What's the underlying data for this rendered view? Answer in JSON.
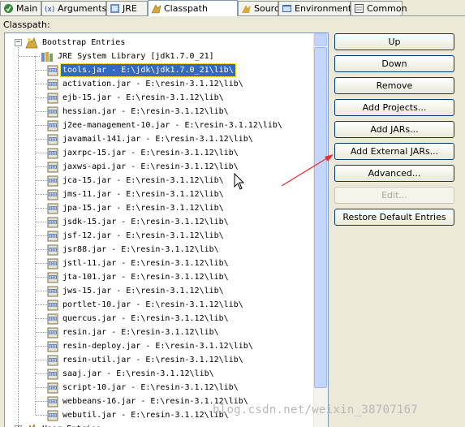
{
  "tabs": [
    {
      "label": "Main",
      "icon": "main-icon"
    },
    {
      "label": "Arguments",
      "icon": "arguments-icon"
    },
    {
      "label": "JRE",
      "icon": "jre-icon"
    },
    {
      "label": "Classpath",
      "icon": "classpath-icon",
      "active": true
    },
    {
      "label": "Source",
      "icon": "source-icon"
    },
    {
      "label": "Environment",
      "icon": "environment-icon"
    },
    {
      "label": "Common",
      "icon": "common-icon"
    }
  ],
  "classpath_label": "Classpath:",
  "tree": {
    "root": "Bootstrap Entries",
    "jre_library": "JRE System Library [jdk1.7.0_21]",
    "entries": [
      "tools.jar - E:\\jdk\\jdk1.7.0_21\\lib\\",
      "activation.jar - E:\\resin-3.1.12\\lib\\",
      "ejb-15.jar - E:\\resin-3.1.12\\lib\\",
      "hessian.jar - E:\\resin-3.1.12\\lib\\",
      "j2ee-management-10.jar - E:\\resin-3.1.12\\lib\\",
      "javamail-141.jar - E:\\resin-3.1.12\\lib\\",
      "jaxrpc-15.jar - E:\\resin-3.1.12\\lib\\",
      "jaxws-api.jar - E:\\resin-3.1.12\\lib\\",
      "jca-15.jar - E:\\resin-3.1.12\\lib\\",
      "jms-11.jar - E:\\resin-3.1.12\\lib\\",
      "jpa-15.jar - E:\\resin-3.1.12\\lib\\",
      "jsdk-15.jar - E:\\resin-3.1.12\\lib\\",
      "jsf-12.jar - E:\\resin-3.1.12\\lib\\",
      "jsr88.jar - E:\\resin-3.1.12\\lib\\",
      "jstl-11.jar - E:\\resin-3.1.12\\lib\\",
      "jta-101.jar - E:\\resin-3.1.12\\lib\\",
      "jws-15.jar - E:\\resin-3.1.12\\lib\\",
      "portlet-10.jar - E:\\resin-3.1.12\\lib\\",
      "quercus.jar - E:\\resin-3.1.12\\lib\\",
      "resin.jar - E:\\resin-3.1.12\\lib\\",
      "resin-deploy.jar - E:\\resin-3.1.12\\lib\\",
      "resin-util.jar - E:\\resin-3.1.12\\lib\\",
      "saaj.jar - E:\\resin-3.1.12\\lib\\",
      "script-10.jar - E:\\resin-3.1.12\\lib\\",
      "webbeans-16.jar - E:\\resin-3.1.12\\lib\\",
      "webutil.jar - E:\\resin-3.1.12\\lib\\"
    ],
    "selected_index": 0,
    "next_root_partial": "User Entries"
  },
  "buttons": [
    {
      "label": "Up",
      "name": "up-button",
      "enabled": true
    },
    {
      "label": "Down",
      "name": "down-button",
      "enabled": true
    },
    {
      "label": "Remove",
      "name": "remove-button",
      "enabled": true
    },
    {
      "label": "Add Projects...",
      "name": "add-projects-button",
      "enabled": true
    },
    {
      "label": "Add JARs...",
      "name": "add-jars-button",
      "enabled": true
    },
    {
      "label": "Add External JARs...",
      "name": "add-external-jars-button",
      "enabled": true
    },
    {
      "label": "Advanced...",
      "name": "advanced-button",
      "enabled": true
    },
    {
      "label": "Edit...",
      "name": "edit-button",
      "enabled": false
    },
    {
      "label": "Restore Default Entries",
      "name": "restore-default-entries-button",
      "enabled": true
    }
  ],
  "watermark": "blog.csdn.net/weixin_38707167",
  "colors": {
    "selection": "#316ac5",
    "annotation_arrow": "#e8302a"
  }
}
